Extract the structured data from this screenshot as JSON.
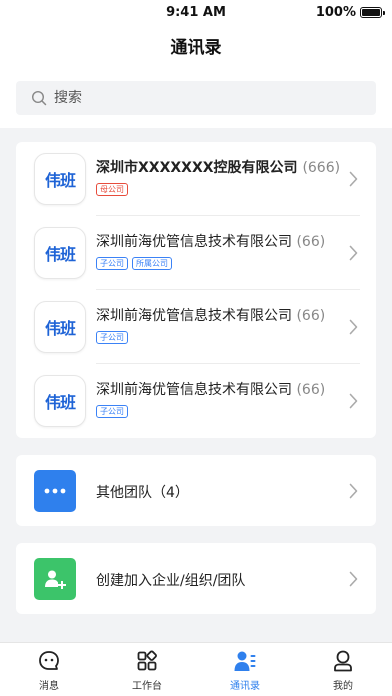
{
  "status_bar": {
    "time": "9:41 AM",
    "battery": "100%"
  },
  "header": {
    "title": "通讯录"
  },
  "search": {
    "placeholder": "搜索"
  },
  "companies": [
    {
      "logo_text": "伟班",
      "name": "深圳市XXXXXXX控股有限公司",
      "count": "(666)",
      "tags": [
        "母公司"
      ]
    },
    {
      "logo_text": "伟班",
      "name": "深圳前海优管信息技术有限公司",
      "count": "(66)",
      "tags": [
        "子公司",
        "所属公司"
      ]
    },
    {
      "logo_text": "伟班",
      "name": "深圳前海优管信息技术有限公司",
      "count": "(66)",
      "tags": [
        "子公司"
      ]
    },
    {
      "logo_text": "伟班",
      "name": "深圳前海优管信息技术有限公司",
      "count": "(66)",
      "tags": [
        "子公司"
      ]
    }
  ],
  "other_team": {
    "icon": "more-dots-icon",
    "label": "其他团队（4）"
  },
  "create_org": {
    "icon": "add-user-icon",
    "label": "创建加入企业/组织/团队"
  },
  "tabbar": {
    "active_color": "#2f80ed",
    "items": [
      {
        "label": "消息",
        "icon": "message-icon"
      },
      {
        "label": "工作台",
        "icon": "workbench-icon"
      },
      {
        "label": "通讯录",
        "icon": "contacts-icon"
      },
      {
        "label": "我的",
        "icon": "profile-icon"
      }
    ]
  }
}
